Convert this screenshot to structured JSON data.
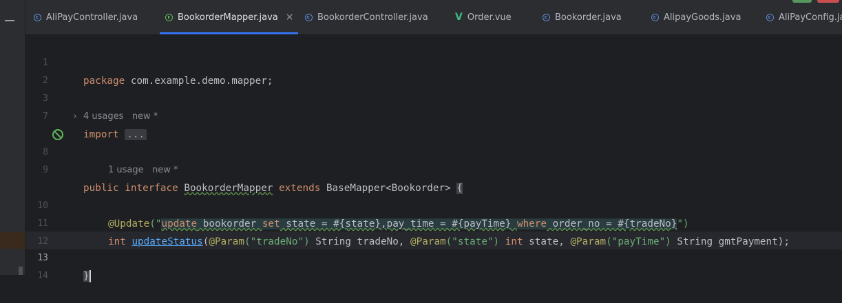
{
  "tabs": [
    {
      "label": "AliPayController.java",
      "icon": "class-icon"
    },
    {
      "label": "BookorderMapper.java",
      "icon": "interface-icon",
      "active": true,
      "close": "×"
    },
    {
      "label": "BookorderController.java",
      "icon": "class-icon"
    },
    {
      "label": "Order.vue",
      "icon": "vue-icon"
    },
    {
      "label": "Bookorder.java",
      "icon": "class-icon"
    },
    {
      "label": "AlipayGoods.java",
      "icon": "class-icon"
    },
    {
      "label": "AliPayConfig.java",
      "icon": "class-icon"
    }
  ],
  "lines": {
    "n1": "1",
    "n2": "2",
    "n3": "3",
    "n7": "7",
    "n8": "8",
    "n9": "9",
    "n10": "10",
    "n11": "11",
    "n12": "12",
    "n13": "13",
    "n14": "14"
  },
  "code": {
    "l1_kw": "package",
    "l1_rest": " com.example.demo.mapper;",
    "l3_kw": "import",
    "l3_fold": "...",
    "usage_interface": "4 usages",
    "usage_interface_new": "new *",
    "l8_kw1": "public",
    "l8_kw2": "interface",
    "l8_name": "BookorderMapper",
    "l8_kw3": "extends",
    "l8_rest": "BaseMapper<Bookorder>",
    "l8_brace": "{",
    "usage_method": "1 usage",
    "usage_method_new": "new *",
    "l10_ann": "@Update",
    "l10_open": "(\"",
    "l10_sql_kw1": "update",
    "l10_sql_t1": " bookorder ",
    "l10_sql_kw2": "set",
    "l10_sql_t2": " state = #{state},pay_time = #{payTime} ",
    "l10_sql_kw3": "where",
    "l10_sql_t3": " order_no = #{tradeNo}",
    "l10_close": "\")",
    "l11_kw": "int",
    "l11_fn": "updateStatus",
    "l11_p1a": "(",
    "l11_ann1": "@Param",
    "l11_s1": "(\"tradeNo\")",
    "l11_t1": " String tradeNo, ",
    "l11_ann2": "@Param",
    "l11_s2": "(\"state\")",
    "l11_kw2": " int",
    "l11_t2": " state, ",
    "l11_ann3": "@Param",
    "l11_s3": "(\"payTime\")",
    "l11_t3": " String gmtPayment);",
    "l13_brace": "}"
  },
  "colors": {
    "keyword": "#cf8e6d",
    "string": "#6aab73",
    "annotation": "#b3ae60",
    "method": "#56a8f5",
    "accent": "#3574f0"
  }
}
